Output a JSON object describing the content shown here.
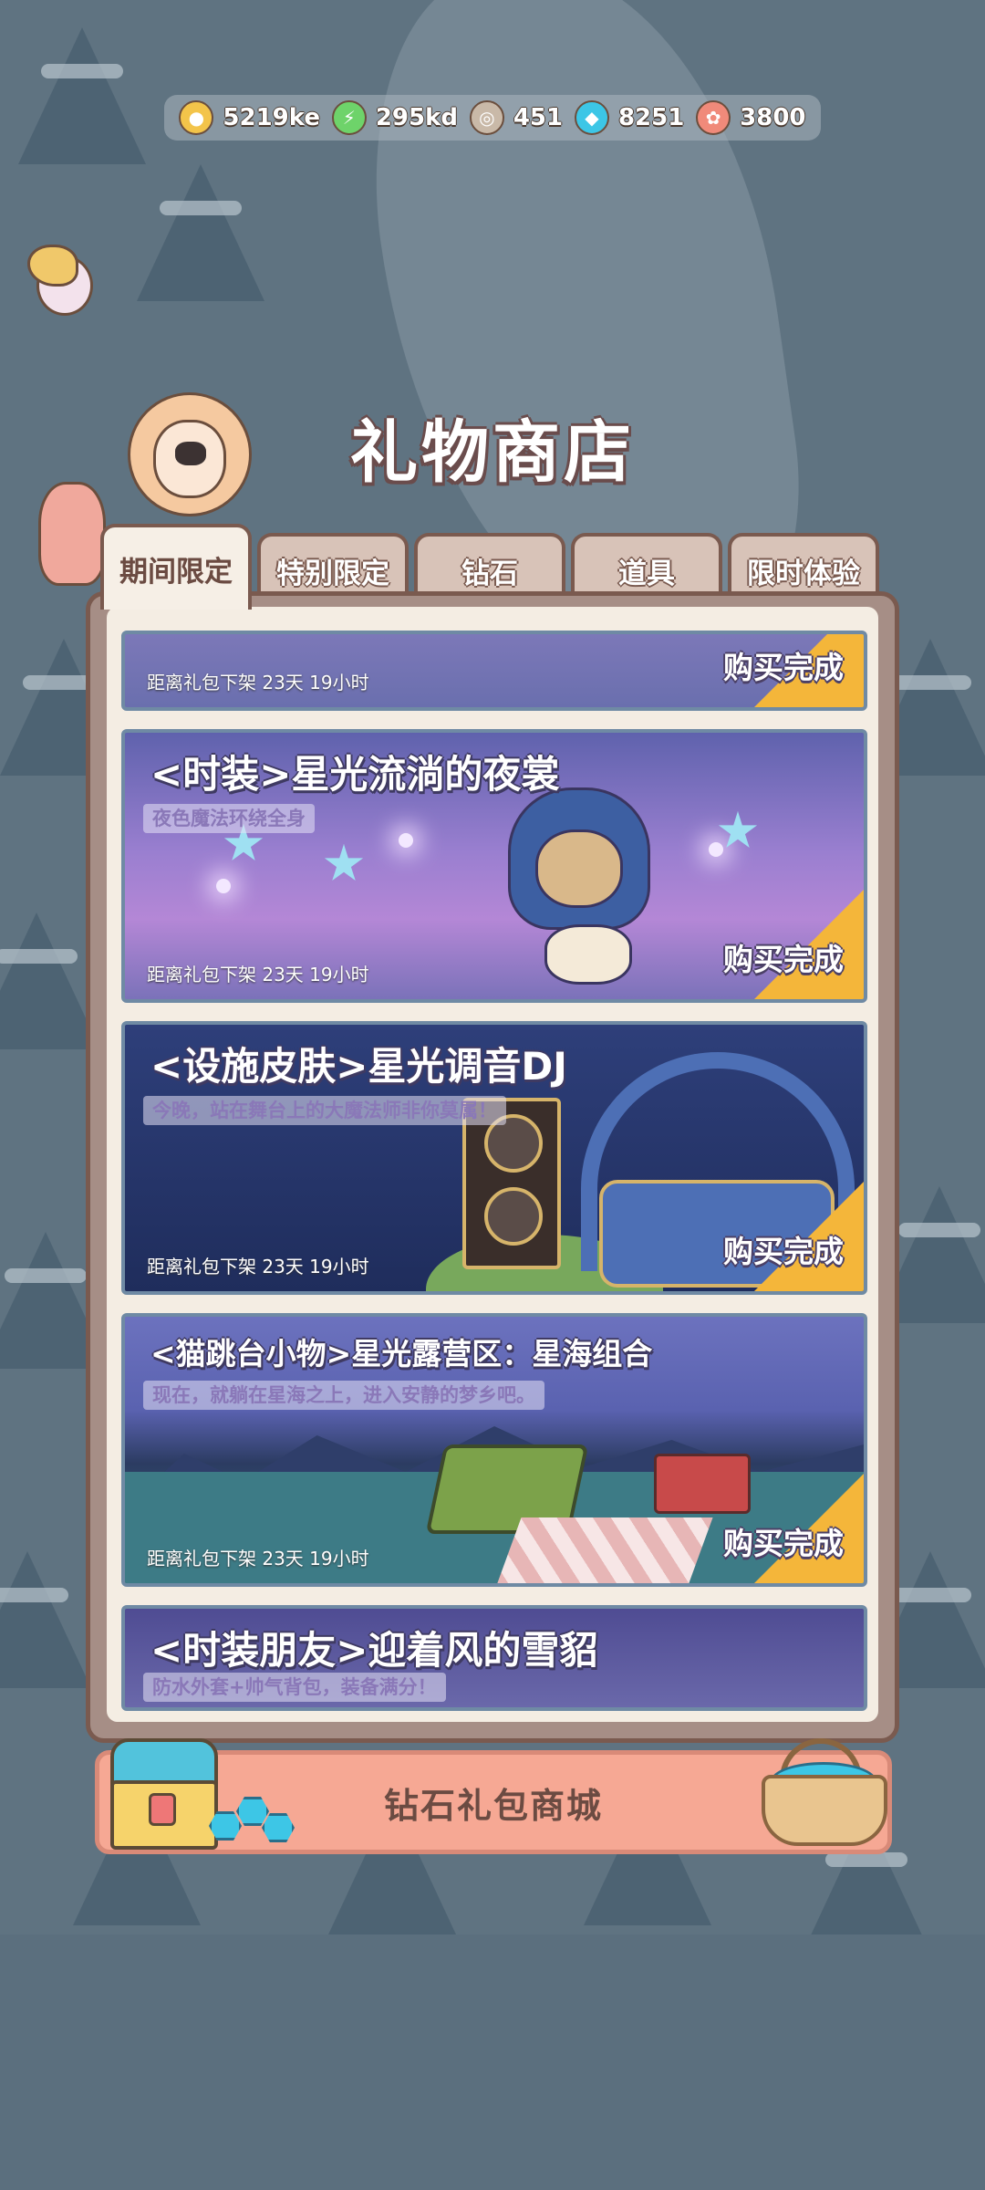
{
  "currency": [
    {
      "icon": "coin-icon",
      "value": "5219ke",
      "color": "#f3c44a"
    },
    {
      "icon": "lightning-icon",
      "value": "295kd",
      "color": "#6ed36a"
    },
    {
      "icon": "token-icon",
      "value": "451",
      "color": "#c9b9a8"
    },
    {
      "icon": "diamond-icon",
      "value": "8251",
      "color": "#3dc6e6"
    },
    {
      "icon": "donut-icon",
      "value": "3800",
      "color": "#f08a7a"
    }
  ],
  "title": "礼物商店",
  "tabs": [
    {
      "label": "期间限定",
      "active": true
    },
    {
      "label": "特别限定",
      "active": false
    },
    {
      "label": "钻石",
      "active": false
    },
    {
      "label": "道具",
      "active": false
    },
    {
      "label": "限时体验",
      "active": false
    }
  ],
  "cards": [
    {
      "title": "",
      "desc": "",
      "timer": "距离礼包下架 23天 19小时",
      "status": "购买完成"
    },
    {
      "title": "<时装>星光流淌的夜裳",
      "desc": "夜色魔法环绕全身",
      "timer": "距离礼包下架 23天 19小时",
      "status": "购买完成"
    },
    {
      "title": "<设施皮肤>星光调音DJ",
      "desc": "今晚，站在舞台上的大魔法师非你莫属！",
      "timer": "距离礼包下架 23天 19小时",
      "status": "购买完成"
    },
    {
      "title": "<猫跳台小物>星光露营区：星海组合",
      "desc": "现在，就躺在星海之上，进入安静的梦乡吧。",
      "timer": "距离礼包下架 23天 19小时",
      "status": "购买完成"
    },
    {
      "title": "<时装朋友>迎着风的雪貂",
      "desc": "防水外套+帅气背包，装备满分！",
      "timer": "",
      "status": ""
    }
  ],
  "banner": {
    "label": "钻石礼包商城"
  }
}
